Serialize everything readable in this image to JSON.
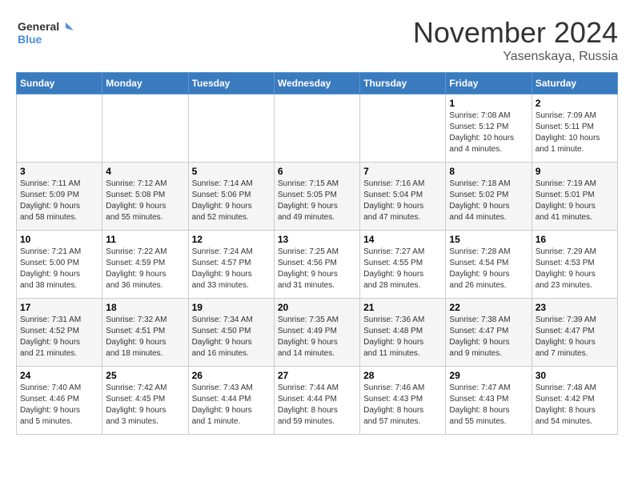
{
  "logo": {
    "line1": "General",
    "line2": "Blue"
  },
  "title": "November 2024",
  "location": "Yasenskaya, Russia",
  "weekdays": [
    "Sunday",
    "Monday",
    "Tuesday",
    "Wednesday",
    "Thursday",
    "Friday",
    "Saturday"
  ],
  "weeks": [
    [
      {
        "day": "",
        "info": ""
      },
      {
        "day": "",
        "info": ""
      },
      {
        "day": "",
        "info": ""
      },
      {
        "day": "",
        "info": ""
      },
      {
        "day": "",
        "info": ""
      },
      {
        "day": "1",
        "info": "Sunrise: 7:08 AM\nSunset: 5:12 PM\nDaylight: 10 hours\nand 4 minutes."
      },
      {
        "day": "2",
        "info": "Sunrise: 7:09 AM\nSunset: 5:11 PM\nDaylight: 10 hours\nand 1 minute."
      }
    ],
    [
      {
        "day": "3",
        "info": "Sunrise: 7:11 AM\nSunset: 5:09 PM\nDaylight: 9 hours\nand 58 minutes."
      },
      {
        "day": "4",
        "info": "Sunrise: 7:12 AM\nSunset: 5:08 PM\nDaylight: 9 hours\nand 55 minutes."
      },
      {
        "day": "5",
        "info": "Sunrise: 7:14 AM\nSunset: 5:06 PM\nDaylight: 9 hours\nand 52 minutes."
      },
      {
        "day": "6",
        "info": "Sunrise: 7:15 AM\nSunset: 5:05 PM\nDaylight: 9 hours\nand 49 minutes."
      },
      {
        "day": "7",
        "info": "Sunrise: 7:16 AM\nSunset: 5:04 PM\nDaylight: 9 hours\nand 47 minutes."
      },
      {
        "day": "8",
        "info": "Sunrise: 7:18 AM\nSunset: 5:02 PM\nDaylight: 9 hours\nand 44 minutes."
      },
      {
        "day": "9",
        "info": "Sunrise: 7:19 AM\nSunset: 5:01 PM\nDaylight: 9 hours\nand 41 minutes."
      }
    ],
    [
      {
        "day": "10",
        "info": "Sunrise: 7:21 AM\nSunset: 5:00 PM\nDaylight: 9 hours\nand 38 minutes."
      },
      {
        "day": "11",
        "info": "Sunrise: 7:22 AM\nSunset: 4:59 PM\nDaylight: 9 hours\nand 36 minutes."
      },
      {
        "day": "12",
        "info": "Sunrise: 7:24 AM\nSunset: 4:57 PM\nDaylight: 9 hours\nand 33 minutes."
      },
      {
        "day": "13",
        "info": "Sunrise: 7:25 AM\nSunset: 4:56 PM\nDaylight: 9 hours\nand 31 minutes."
      },
      {
        "day": "14",
        "info": "Sunrise: 7:27 AM\nSunset: 4:55 PM\nDaylight: 9 hours\nand 28 minutes."
      },
      {
        "day": "15",
        "info": "Sunrise: 7:28 AM\nSunset: 4:54 PM\nDaylight: 9 hours\nand 26 minutes."
      },
      {
        "day": "16",
        "info": "Sunrise: 7:29 AM\nSunset: 4:53 PM\nDaylight: 9 hours\nand 23 minutes."
      }
    ],
    [
      {
        "day": "17",
        "info": "Sunrise: 7:31 AM\nSunset: 4:52 PM\nDaylight: 9 hours\nand 21 minutes."
      },
      {
        "day": "18",
        "info": "Sunrise: 7:32 AM\nSunset: 4:51 PM\nDaylight: 9 hours\nand 18 minutes."
      },
      {
        "day": "19",
        "info": "Sunrise: 7:34 AM\nSunset: 4:50 PM\nDaylight: 9 hours\nand 16 minutes."
      },
      {
        "day": "20",
        "info": "Sunrise: 7:35 AM\nSunset: 4:49 PM\nDaylight: 9 hours\nand 14 minutes."
      },
      {
        "day": "21",
        "info": "Sunrise: 7:36 AM\nSunset: 4:48 PM\nDaylight: 9 hours\nand 11 minutes."
      },
      {
        "day": "22",
        "info": "Sunrise: 7:38 AM\nSunset: 4:47 PM\nDaylight: 9 hours\nand 9 minutes."
      },
      {
        "day": "23",
        "info": "Sunrise: 7:39 AM\nSunset: 4:47 PM\nDaylight: 9 hours\nand 7 minutes."
      }
    ],
    [
      {
        "day": "24",
        "info": "Sunrise: 7:40 AM\nSunset: 4:46 PM\nDaylight: 9 hours\nand 5 minutes."
      },
      {
        "day": "25",
        "info": "Sunrise: 7:42 AM\nSunset: 4:45 PM\nDaylight: 9 hours\nand 3 minutes."
      },
      {
        "day": "26",
        "info": "Sunrise: 7:43 AM\nSunset: 4:44 PM\nDaylight: 9 hours\nand 1 minute."
      },
      {
        "day": "27",
        "info": "Sunrise: 7:44 AM\nSunset: 4:44 PM\nDaylight: 8 hours\nand 59 minutes."
      },
      {
        "day": "28",
        "info": "Sunrise: 7:46 AM\nSunset: 4:43 PM\nDaylight: 8 hours\nand 57 minutes."
      },
      {
        "day": "29",
        "info": "Sunrise: 7:47 AM\nSunset: 4:43 PM\nDaylight: 8 hours\nand 55 minutes."
      },
      {
        "day": "30",
        "info": "Sunrise: 7:48 AM\nSunset: 4:42 PM\nDaylight: 8 hours\nand 54 minutes."
      }
    ]
  ]
}
